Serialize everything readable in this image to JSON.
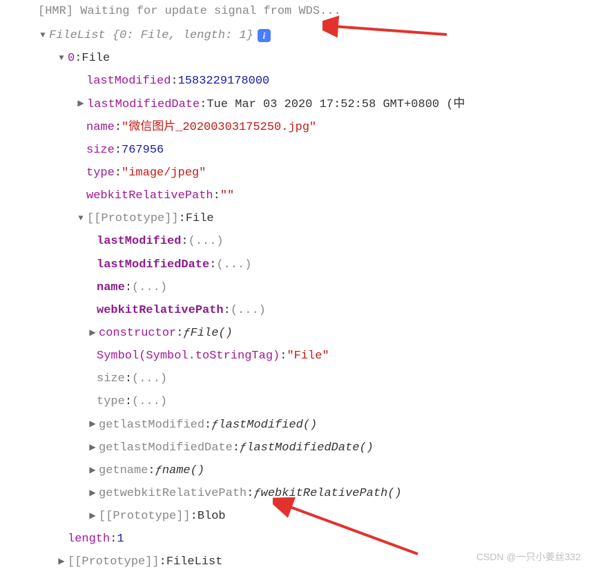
{
  "top_cut": "[HMR] Waiting for update signal from WDS...",
  "root": {
    "summary_prefix": "FileList {",
    "summary_key0": "0",
    "summary_val0": "File",
    "summary_key1": "length",
    "summary_val1": "1",
    "summary_suffix": "}"
  },
  "entry0": {
    "key": "0",
    "type": "File"
  },
  "file": {
    "lastModified_key": "lastModified",
    "lastModified_val": "1583229178000",
    "lastModifiedDate_key": "lastModifiedDate",
    "lastModifiedDate_val": "Tue Mar 03 2020 17:52:58 GMT+0800 (中",
    "name_key": "name",
    "name_val": "\"微信图片_20200303175250.jpg\"",
    "size_key": "size",
    "size_val": "767956",
    "type_key": "type",
    "type_val": "\"image/jpeg\"",
    "wrp_key": "webkitRelativePath",
    "wrp_val": "\"\""
  },
  "proto": {
    "label": "[[Prototype]]",
    "type": "File",
    "lastModified": "lastModified",
    "lastModifiedDate": "lastModifiedDate",
    "name": "name",
    "wrp": "webkitRelativePath",
    "ellipsis": "(...)",
    "constructor_key": "constructor",
    "f": "ƒ",
    "file_fn": "File()",
    "symbol_key": "Symbol(Symbol.toStringTag)",
    "symbol_val": "\"File\"",
    "size": "size",
    "type_k": "type",
    "get": "get",
    "get_lm": "lastModified",
    "get_lm_fn": "lastModified()",
    "get_lmd": "lastModifiedDate",
    "get_lmd_fn": "lastModifiedDate()",
    "get_name": "name",
    "get_name_fn": "name()",
    "get_wrp": "webkitRelativePath",
    "get_wrp_fn": "webkitRelativePath()",
    "proto2_type": "Blob"
  },
  "length": {
    "key": "length",
    "val": "1"
  },
  "proto_outer": {
    "label": "[[Prototype]]",
    "type": "FileList"
  },
  "watermark": "CSDN @一只小姜丝332"
}
